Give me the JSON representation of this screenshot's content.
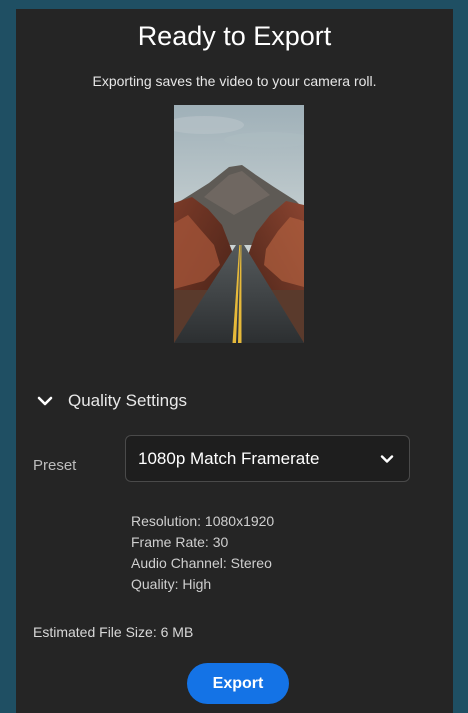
{
  "header": {
    "title": "Ready to Export",
    "subtitle": "Exporting saves the video to your camera roll."
  },
  "preview": {
    "icon": "video-thumbnail"
  },
  "quality": {
    "section_label": "Quality Settings",
    "expanded": true,
    "preset_label": "Preset",
    "preset_value": "1080p Match Framerate",
    "details": {
      "resolution": "Resolution: 1080x1920",
      "frame_rate": "Frame Rate: 30",
      "audio_channel": "Audio Channel: Stereo",
      "quality": "Quality: High"
    }
  },
  "file": {
    "estimated_size": "Estimated File Size: 6 MB"
  },
  "actions": {
    "export_label": "Export"
  },
  "colors": {
    "background": "#252525",
    "border": "#1f4f63",
    "accent": "#1473e6"
  }
}
